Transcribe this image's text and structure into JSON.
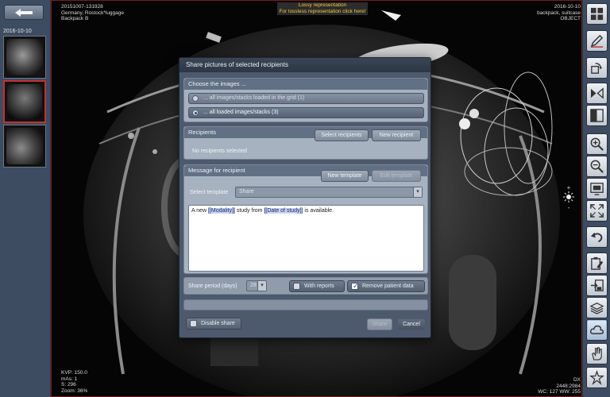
{
  "left_panel": {
    "back_icon": "arrow-left-icon",
    "series_date": "2016-10-10"
  },
  "overlay": {
    "top_left": [
      "20151007-131928",
      "Germany, Rostock*luggage",
      "Backpack B"
    ],
    "top_right": [
      "2016-10-10",
      "backpack, suitcase",
      "OBJECT"
    ],
    "lossy_line1": "Lossy representation",
    "lossy_line2": "For lossless representation click here!",
    "bottom_left": [
      "KVP: 150.0",
      "mAs: 1",
      "S: 296",
      "Zoom: 36%"
    ],
    "bottom_right": [
      "DX",
      "2448:2984",
      "WC: 127 WW: 255"
    ]
  },
  "dialog": {
    "title": "Share pictures of selected recipients",
    "images_section": {
      "heading": "Choose the images ...",
      "option1": "... all images/stacks loaded in the grid (1)",
      "option2": "... all loaded images/stacks (3)",
      "selected": 2
    },
    "recipients_section": {
      "heading": "Recipients",
      "select_label": "Select recipients",
      "new_label": "New recipient",
      "empty_text": "No recipients selected"
    },
    "message_section": {
      "heading": "Message for recipient",
      "new_template_label": "New template",
      "edit_template_label": "Edit template",
      "select_template_label": "Select template",
      "template_value": "Share",
      "message_prefix": "A new ",
      "placeholder1": "[[Modality]]",
      "message_mid": " study from ",
      "placeholder2": "[[Date of study]]",
      "message_suffix": " is available."
    },
    "period": {
      "label": "Share period (days)",
      "value": "28",
      "with_reports_label": "With reports",
      "with_reports_checked": false,
      "remove_data_label": "Remove patient data",
      "remove_data_checked": true
    },
    "disable_share_label": "Disable share",
    "share_label": "Share",
    "cancel_label": "Cancel"
  },
  "toolbar": {
    "icons": [
      "grid-layout-icon",
      "pen-edit-icon",
      "rotate-90-icon",
      "flip-horizontal-icon",
      "split-view-icon",
      "zoom-in-icon",
      "zoom-out-icon",
      "fit-screen-icon",
      "fullscreen-icon",
      "undo-icon",
      "clipboard-edit-icon",
      "export-icon",
      "stack-layers-icon",
      "cloud-share-icon",
      "hand-icon",
      "magic-icon"
    ]
  },
  "brightness": {
    "plus": "+",
    "minus": "-",
    "icon": "sun-icon"
  }
}
